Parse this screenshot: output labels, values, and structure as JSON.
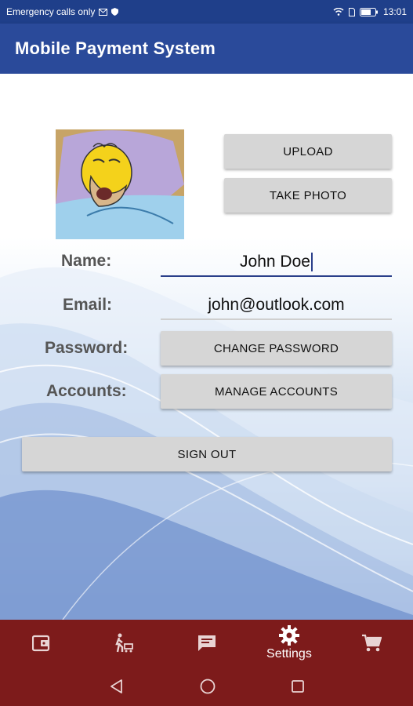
{
  "status_bar": {
    "left_text": "Emergency calls only",
    "time": "13:01"
  },
  "app_bar": {
    "title": "Mobile Payment System"
  },
  "profile": {
    "upload_label": "UPLOAD",
    "take_photo_label": "TAKE PHOTO",
    "name_label": "Name:",
    "name_value": "John Doe",
    "email_label": "Email:",
    "email_value": "john@outlook.com",
    "password_label": "Password:",
    "change_password_label": "CHANGE PASSWORD",
    "accounts_label": "Accounts:",
    "manage_accounts_label": "MANAGE ACCOUNTS",
    "sign_out_label": "SIGN OUT"
  },
  "bottom_nav": {
    "items": [
      {
        "icon": "wallet-icon",
        "label": ""
      },
      {
        "icon": "walking-cart-icon",
        "label": ""
      },
      {
        "icon": "chat-icon",
        "label": ""
      },
      {
        "icon": "gear-icon",
        "label": "Settings",
        "active": true
      },
      {
        "icon": "cart-icon",
        "label": ""
      }
    ]
  },
  "colors": {
    "status_bar": "#1f3f8a",
    "app_bar": "#2a4a9a",
    "bottom_nav": "#7d1b1b",
    "button": "#d6d6d6"
  }
}
